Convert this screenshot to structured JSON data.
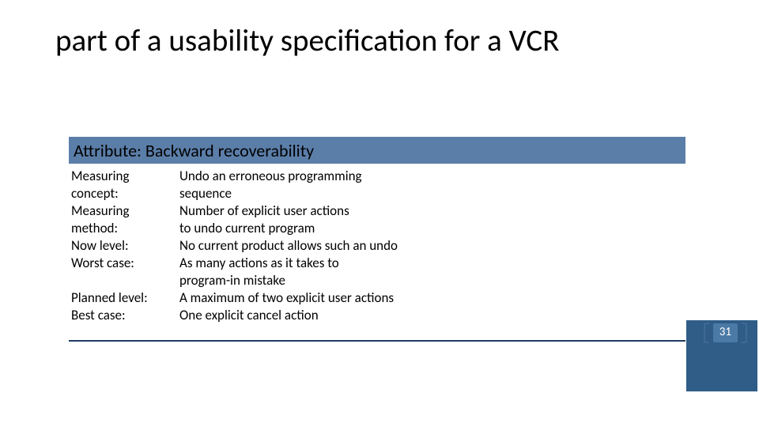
{
  "title": "part of a usability specification for a VCR",
  "attribute": "Attribute:  Backward recoverability",
  "rows": [
    {
      "label": "Measuring concept:",
      "value": "Undo an erroneous programming\nsequence"
    },
    {
      "label": "Measuring method:",
      "value": "Number of explicit user actions\nto undo current program"
    },
    {
      "label": "Now level:",
      "value": "No current product allows such an undo"
    },
    {
      "label": "Worst case:",
      "value": "As many actions as it takes to\nprogram-in mistake"
    },
    {
      "label": "Planned level:",
      "value": "A maximum of two explicit user actions"
    },
    {
      "label": "Best case:",
      "value": "One explicit cancel action"
    }
  ],
  "pageNumber": "31",
  "colors": {
    "band": "#5b7ea9",
    "block": "#2f5d88",
    "badge": "#4a7aa5",
    "bracket": "#3f6a95"
  }
}
